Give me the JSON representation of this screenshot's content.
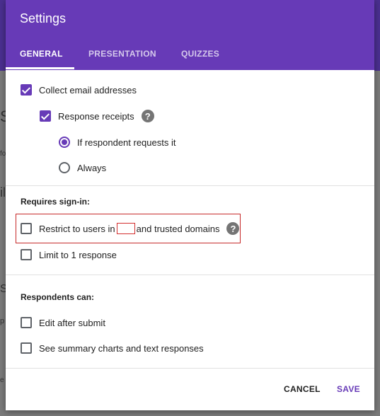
{
  "dialog": {
    "title": "Settings",
    "tabs": [
      {
        "label": "GENERAL",
        "active": true
      },
      {
        "label": "PRESENTATION",
        "active": false
      },
      {
        "label": "QUIZZES",
        "active": false
      }
    ]
  },
  "general": {
    "collect_email": {
      "label": "Collect email addresses",
      "checked": true
    },
    "response_receipts": {
      "label": "Response receipts",
      "checked": true
    },
    "receipt_options": [
      {
        "label": "If respondent requests it",
        "selected": true
      },
      {
        "label": "Always",
        "selected": false
      }
    ],
    "requires_signin": {
      "heading": "Requires sign-in:",
      "restrict_prefix": "Restrict to users in",
      "restrict_suffix": "and trusted domains",
      "restrict_checked": false,
      "limit_label": "Limit to 1 response",
      "limit_checked": false
    },
    "respondents_can": {
      "heading": "Respondents can:",
      "edit_label": "Edit after submit",
      "edit_checked": false,
      "summary_label": "See summary charts and text responses",
      "summary_checked": false
    }
  },
  "help_glyph": "?",
  "background_fragments": [
    "S",
    "fo",
    "il",
    "S",
    "p",
    "e"
  ],
  "actions": {
    "cancel": "CANCEL",
    "save": "SAVE"
  },
  "colors": {
    "header": "#673ab7",
    "accent": "#673ab7",
    "overlay": "#7a7a7a",
    "highlight": "#c62828"
  }
}
